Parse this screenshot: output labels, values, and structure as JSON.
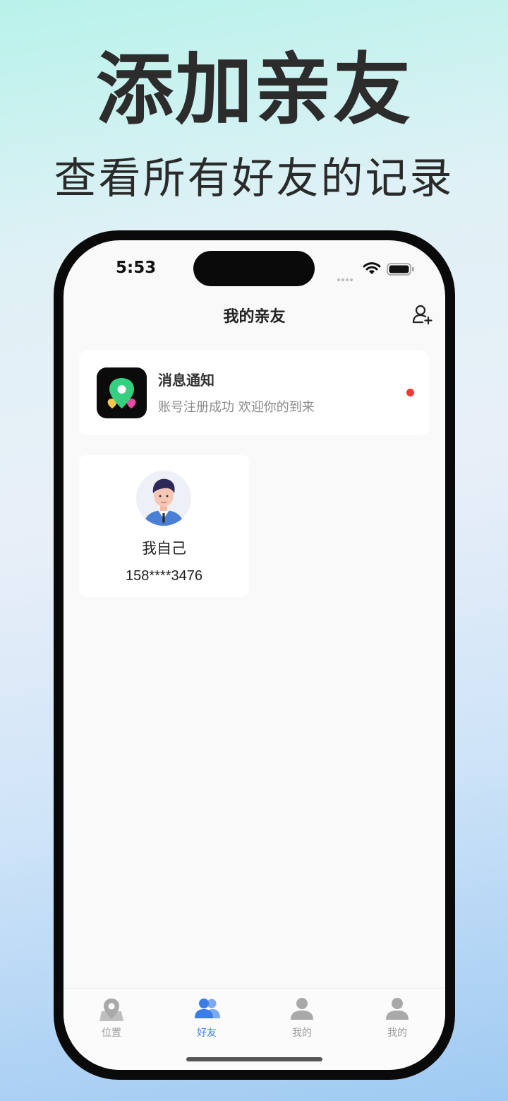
{
  "promo": {
    "title": "添加亲友",
    "subtitle": "查看所有好友的记录"
  },
  "status_bar": {
    "time": "5:53",
    "icons": [
      "cellular-dots-icon",
      "wifi-icon",
      "battery-icon"
    ]
  },
  "nav": {
    "title": "我的亲友",
    "action_icon": "add-user-icon"
  },
  "notice": {
    "icon": "location-pins-app-icon",
    "title": "消息通知",
    "message": "账号注册成功 欢迎你的到来",
    "unread_dot_color": "#ef3b33"
  },
  "friends": [
    {
      "name": "我自己",
      "phone": "158****3476",
      "avatar": "man-avatar-icon"
    }
  ],
  "tabbar": {
    "active_color": "#3a7de8",
    "inactive_color": "#9a9a9a",
    "tabs": [
      {
        "label": "位置",
        "icon": "location-pin-icon",
        "active": false
      },
      {
        "label": "好友",
        "icon": "friends-icon",
        "active": true
      },
      {
        "label": "我的",
        "icon": "person-icon",
        "active": false
      },
      {
        "label": "我的",
        "icon": "person-icon",
        "active": false
      }
    ]
  }
}
